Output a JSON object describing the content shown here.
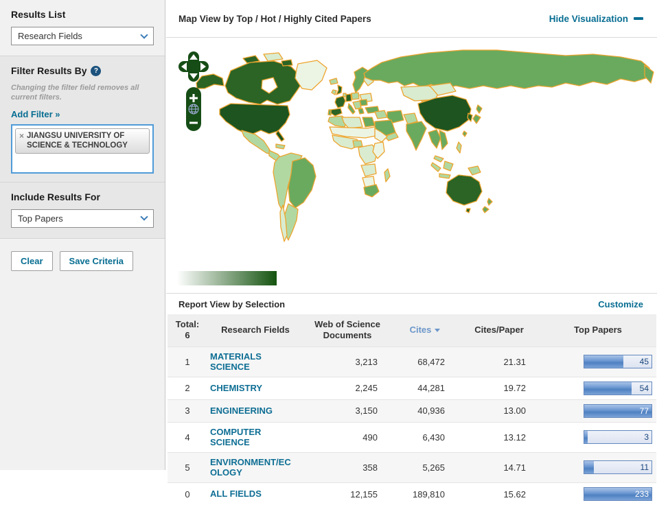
{
  "sidebar": {
    "results_list": {
      "title": "Results List",
      "dropdown_value": "Research Fields"
    },
    "filter": {
      "title": "Filter Results By",
      "help_icon": "?",
      "note": "Changing the filter field removes all current filters.",
      "add_filter_label": "Add Filter »",
      "tag": {
        "remove_icon": "×",
        "label": "JIANGSU UNIVERSITY OF SCIENCE & TECHNOLOGY"
      }
    },
    "include": {
      "title": "Include Results For",
      "dropdown_value": "Top Papers"
    },
    "buttons": {
      "clear": "Clear",
      "save": "Save Criteria"
    }
  },
  "map_section": {
    "title": "Map View by Top / Hot / Highly Cited Papers",
    "hide_link": "Hide Visualization",
    "controls": {
      "zoom_in": "+",
      "zoom_out": "−"
    },
    "legend": {
      "start_color": "#ffffff",
      "end_color": "#14530f"
    },
    "palette": {
      "darkest": "#1d5420",
      "dark": "#2b6425",
      "medium": "#6aaa5e",
      "light": "#b2d8a2",
      "pale": "#d9ecd0",
      "palest": "#ecf5e4",
      "border": "#eda42e",
      "ocean": "#ffffff",
      "control_green": "#164d16",
      "globe_blue": "#aab3e6"
    }
  },
  "report": {
    "title": "Report View by Selection",
    "customize": "Customize",
    "table": {
      "total_label": "Total:",
      "total_value": "6",
      "columns": [
        "Research Fields",
        "Web of Science Documents",
        "Cites",
        "Cites/Paper",
        "Top Papers"
      ],
      "sorted_column": "Cites",
      "rows": [
        {
          "rank": "1",
          "field": "MATERIALS SCIENCE",
          "docs": "3,213",
          "cites": "68,472",
          "cites_per_paper": "21.31",
          "top_papers": "45",
          "bar_pct": 58
        },
        {
          "rank": "2",
          "field": "CHEMISTRY",
          "docs": "2,245",
          "cites": "44,281",
          "cites_per_paper": "19.72",
          "top_papers": "54",
          "bar_pct": 70
        },
        {
          "rank": "3",
          "field": "ENGINEERING",
          "docs": "3,150",
          "cites": "40,936",
          "cites_per_paper": "13.00",
          "top_papers": "77",
          "bar_pct": 100
        },
        {
          "rank": "4",
          "field": "COMPUTER SCIENCE",
          "docs": "490",
          "cites": "6,430",
          "cites_per_paper": "13.12",
          "top_papers": "3",
          "bar_pct": 5
        },
        {
          "rank": "5",
          "field": "ENVIRONMENT/ECOLOGY",
          "docs": "358",
          "cites": "5,265",
          "cites_per_paper": "14.71",
          "top_papers": "11",
          "bar_pct": 14
        },
        {
          "rank": "0",
          "field": "ALL FIELDS",
          "docs": "12,155",
          "cites": "189,810",
          "cites_per_paper": "15.62",
          "top_papers": "233",
          "bar_pct": 100
        }
      ]
    }
  }
}
